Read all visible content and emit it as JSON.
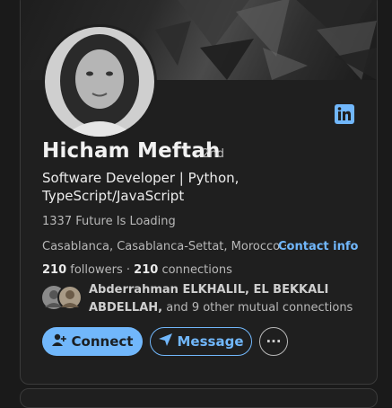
{
  "profile": {
    "name": "Hicham Meftah",
    "degree": "· 2nd",
    "headline": "Software Developer | Python, TypeScript/JavaScript",
    "tagline": "1337 Future Is Loading",
    "location": "Casablanca, Casablanca-Settat, Morocco ·",
    "contact_info": "Contact info",
    "followers_count": "210",
    "followers_label": "followers",
    "connections_count": "210",
    "connections_label": "connections",
    "separator": "·"
  },
  "mutual": {
    "names": "Abderrahman ELKHALIL, EL BEKKALI ABDELLAH,",
    "others": " and 9 other mutual connections"
  },
  "actions": {
    "connect_label": "Connect",
    "message_label": "Message",
    "more_label": "···"
  },
  "icons": {
    "linkedin": "linkedin-icon",
    "connect": "add-person-icon",
    "message": "send-icon",
    "more": "more-icon"
  },
  "colors": {
    "accent": "#71b7fb",
    "card_bg": "#1f1f1f",
    "page_bg": "#1a1a1a"
  }
}
